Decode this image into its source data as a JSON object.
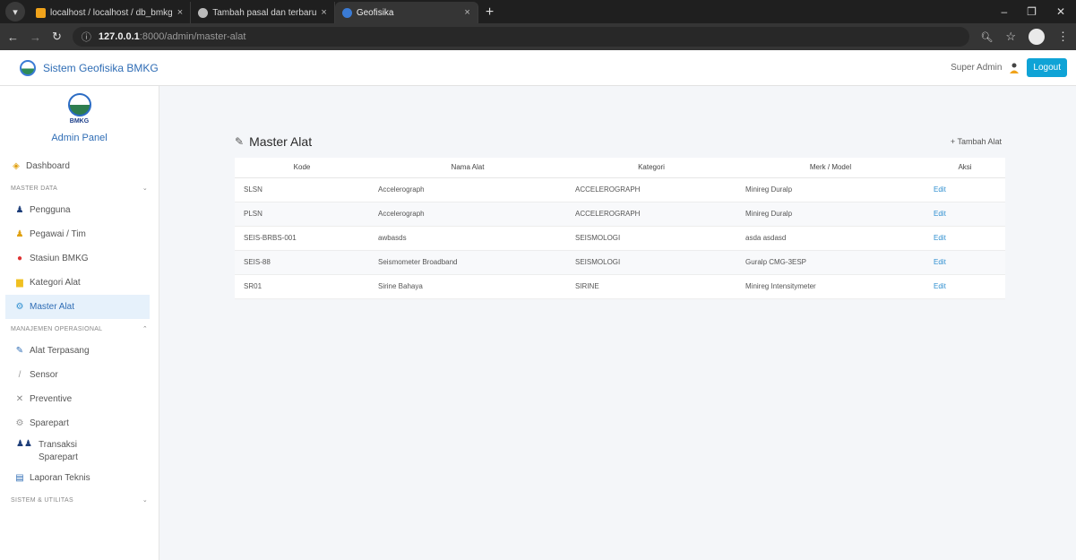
{
  "browser": {
    "tabs": [
      {
        "label": "localhost / localhost / db_bmkg",
        "fav_color": "#f0a31b",
        "active": false
      },
      {
        "label": "Tambah pasal dan terbaru",
        "fav_color": "#bbbbbb",
        "active": false
      },
      {
        "label": "Geofisika",
        "fav_color": "#3a7bd5",
        "active": true
      }
    ],
    "url_host": "127.0.0.1",
    "url_path": ":8000/admin/master-alat"
  },
  "header": {
    "brand": "Sistem Geofisika BMKG",
    "user": "Super Admin",
    "logout_label": "Logout"
  },
  "sidebar": {
    "logo_text": "BMKG",
    "title": "Admin Panel",
    "dashboard": "Dashboard",
    "section_master": "MASTER DATA",
    "master_items": [
      {
        "label": "Pengguna",
        "icon": "user-icon"
      },
      {
        "label": "Pegawai / Tim",
        "icon": "team-icon"
      },
      {
        "label": "Stasiun BMKG",
        "icon": "location-icon"
      },
      {
        "label": "Kategori Alat",
        "icon": "folder-icon"
      },
      {
        "label": "Master Alat",
        "icon": "gear-icon"
      }
    ],
    "section_ops": "MANAJEMEN OPERASIONAL",
    "ops_items": [
      {
        "label": "Alat Terpasang",
        "icon": "tool-icon"
      },
      {
        "label": "Sensor",
        "icon": "sensor-icon"
      },
      {
        "label": "Preventive",
        "icon": "preventive-icon"
      },
      {
        "label": "Sparepart",
        "icon": "sparepart-icon"
      },
      {
        "label": "Transaksi Sparepart",
        "icon": "transaction-icon"
      },
      {
        "label": "Laporan Teknis",
        "icon": "report-icon"
      }
    ],
    "section_system": "SISTEM & UTILITAS"
  },
  "main": {
    "title": "Master Alat",
    "add_label": "+ Tambah Alat",
    "columns": [
      "Kode",
      "Nama Alat",
      "Kategori",
      "Merk / Model",
      "Aksi"
    ],
    "rows": [
      {
        "kode": "SLSN",
        "nama": "Accelerograph",
        "kategori": "ACCELEROGRAPH",
        "merk": "Minireg Duralp",
        "aksi": "Edit"
      },
      {
        "kode": "PLSN",
        "nama": "Accelerograph",
        "kategori": "ACCELEROGRAPH",
        "merk": "Minireg Duralp",
        "aksi": "Edit"
      },
      {
        "kode": "SEIS-BRBS-001",
        "nama": "awbasds",
        "kategori": "SEISMOLOGI",
        "merk": "asda asdasd",
        "aksi": "Edit"
      },
      {
        "kode": "SEIS-88",
        "nama": "Seismometer Broadband",
        "kategori": "SEISMOLOGI",
        "merk": "Guralp CMG-3ESP",
        "aksi": "Edit"
      },
      {
        "kode": "SR01",
        "nama": "Sirine Bahaya",
        "kategori": "SIRINE",
        "merk": "Minireg Intensitymeter",
        "aksi": "Edit"
      }
    ]
  }
}
